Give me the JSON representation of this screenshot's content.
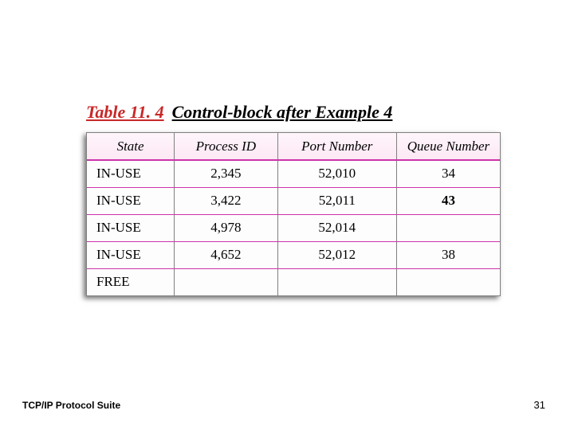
{
  "caption": {
    "ref": "Table 11. 4",
    "title": "Control-block after Example 4"
  },
  "table": {
    "headers": [
      "State",
      "Process ID",
      "Port Number",
      "Queue Number"
    ],
    "rows": [
      {
        "state": "IN-USE",
        "pid": "2,345",
        "port": "52,010",
        "queue": "34",
        "queue_bold": false
      },
      {
        "state": "IN-USE",
        "pid": "3,422",
        "port": "52,011",
        "queue": "43",
        "queue_bold": true
      },
      {
        "state": "IN-USE",
        "pid": "4,978",
        "port": "52,014",
        "queue": "",
        "queue_bold": false
      },
      {
        "state": "IN-USE",
        "pid": "4,652",
        "port": "52,012",
        "queue": "38",
        "queue_bold": false
      },
      {
        "state": "FREE",
        "pid": "",
        "port": "",
        "queue": "",
        "queue_bold": false
      }
    ]
  },
  "footer": {
    "left": "TCP/IP Protocol Suite",
    "page": "31"
  },
  "chart_data": {
    "type": "table",
    "title": "Table 11.4 Control-block after Example 4",
    "columns": [
      "State",
      "Process ID",
      "Port Number",
      "Queue Number"
    ],
    "rows": [
      [
        "IN-USE",
        "2,345",
        "52,010",
        "34"
      ],
      [
        "IN-USE",
        "3,422",
        "52,011",
        "43"
      ],
      [
        "IN-USE",
        "4,978",
        "52,014",
        ""
      ],
      [
        "IN-USE",
        "4,652",
        "52,012",
        "38"
      ],
      [
        "FREE",
        "",
        "",
        ""
      ]
    ]
  }
}
